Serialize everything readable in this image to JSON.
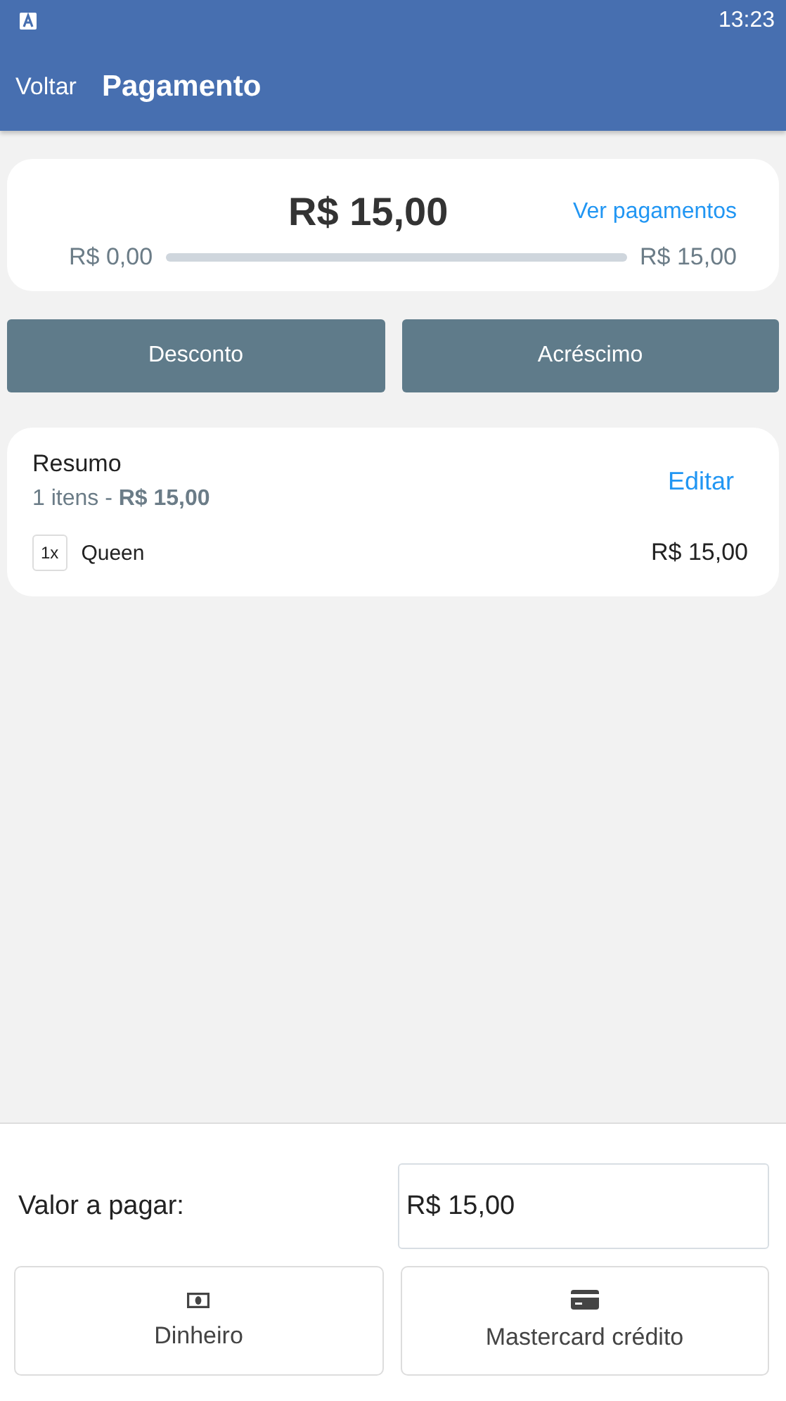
{
  "status_bar": {
    "time": "13:23"
  },
  "app_bar": {
    "back": "Voltar",
    "title": "Pagamento"
  },
  "summary_card": {
    "total": "R$ 15,00",
    "link": "Ver pagamentos",
    "paid": "R$ 0,00",
    "level": 0,
    "goal": "R$ 15,00"
  },
  "adjust_buttons": [
    "Desconto",
    "Acréscimo"
  ],
  "order": {
    "title": "Resumo",
    "subtitle": "1 itens - **R$ 15,00**",
    "edit": "Editar",
    "items": [
      {
        "qty": "1x",
        "name": "Queen",
        "price": "R$ 15,00"
      }
    ]
  },
  "payment": {
    "label": "Valor a pagar:",
    "value": "R$ 15,00",
    "methods": [
      {
        "kind": "cash",
        "label": "Dinheiro"
      },
      {
        "kind": "card",
        "label": "Mastercard crédito"
      }
    ]
  }
}
